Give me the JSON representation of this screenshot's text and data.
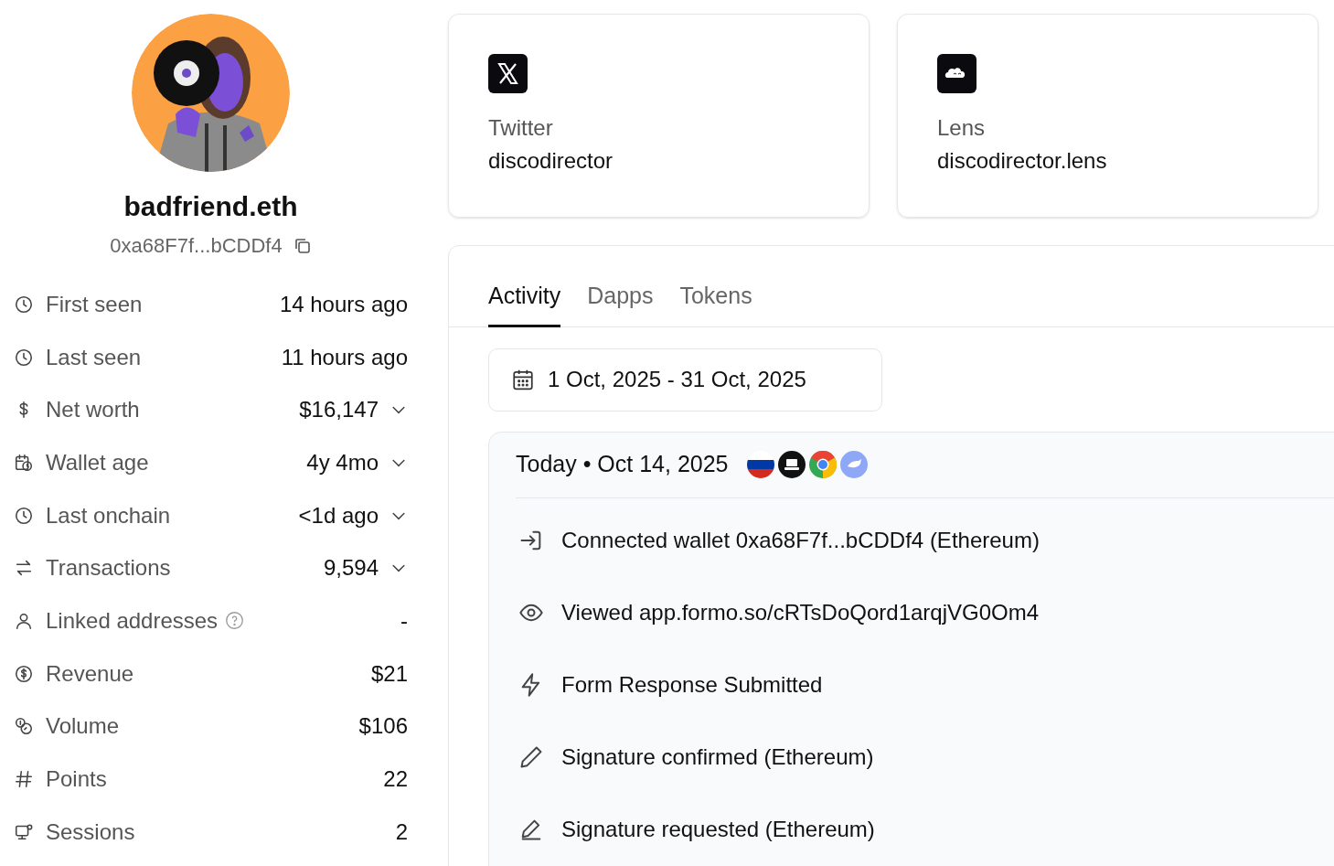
{
  "profile": {
    "name": "badfriend.eth",
    "address": "0xa68F7f...bCDDf4"
  },
  "stats": [
    {
      "label": "First seen",
      "value": "14 hours ago",
      "kind": "plain"
    },
    {
      "label": "Last seen",
      "value": "11 hours ago",
      "kind": "plain"
    },
    {
      "label": "Net worth",
      "value": "$16,147",
      "kind": "dropdown"
    },
    {
      "label": "Wallet age",
      "value": "4y 4mo",
      "kind": "dropdown"
    },
    {
      "label": "Last onchain",
      "value": "<1d ago",
      "kind": "dropdown"
    },
    {
      "label": "Transactions",
      "value": "9,594",
      "kind": "dropdown"
    },
    {
      "label": "Linked addresses",
      "value": "-",
      "kind": "info"
    },
    {
      "label": "Revenue",
      "value": "$21",
      "kind": "plain"
    },
    {
      "label": "Volume",
      "value": "$106",
      "kind": "plain"
    },
    {
      "label": "Points",
      "value": "22",
      "kind": "plain"
    },
    {
      "label": "Sessions",
      "value": "2",
      "kind": "plain"
    }
  ],
  "accounts": [
    {
      "platform": "Twitter",
      "handle": "discodirector"
    },
    {
      "platform": "Lens",
      "handle": "discodirector.lens"
    }
  ],
  "tabs": [
    {
      "label": "Activity",
      "selected": true
    },
    {
      "label": "Dapps",
      "selected": false
    },
    {
      "label": "Tokens",
      "selected": false
    }
  ],
  "date_range": "1 Oct, 2025 - 31 Oct, 2025",
  "timeline": {
    "day": "Today • Oct 14, 2025",
    "events": [
      {
        "text": "Connected wallet 0xa68F7f...bCDDf4 (Ethereum)"
      },
      {
        "text": "Viewed app.formo.so/cRTsDoQord1arqjVG0Om4"
      },
      {
        "text": "Form Response Submitted"
      },
      {
        "text": "Signature confirmed (Ethereum)"
      },
      {
        "text": "Signature requested (Ethereum)"
      }
    ]
  }
}
